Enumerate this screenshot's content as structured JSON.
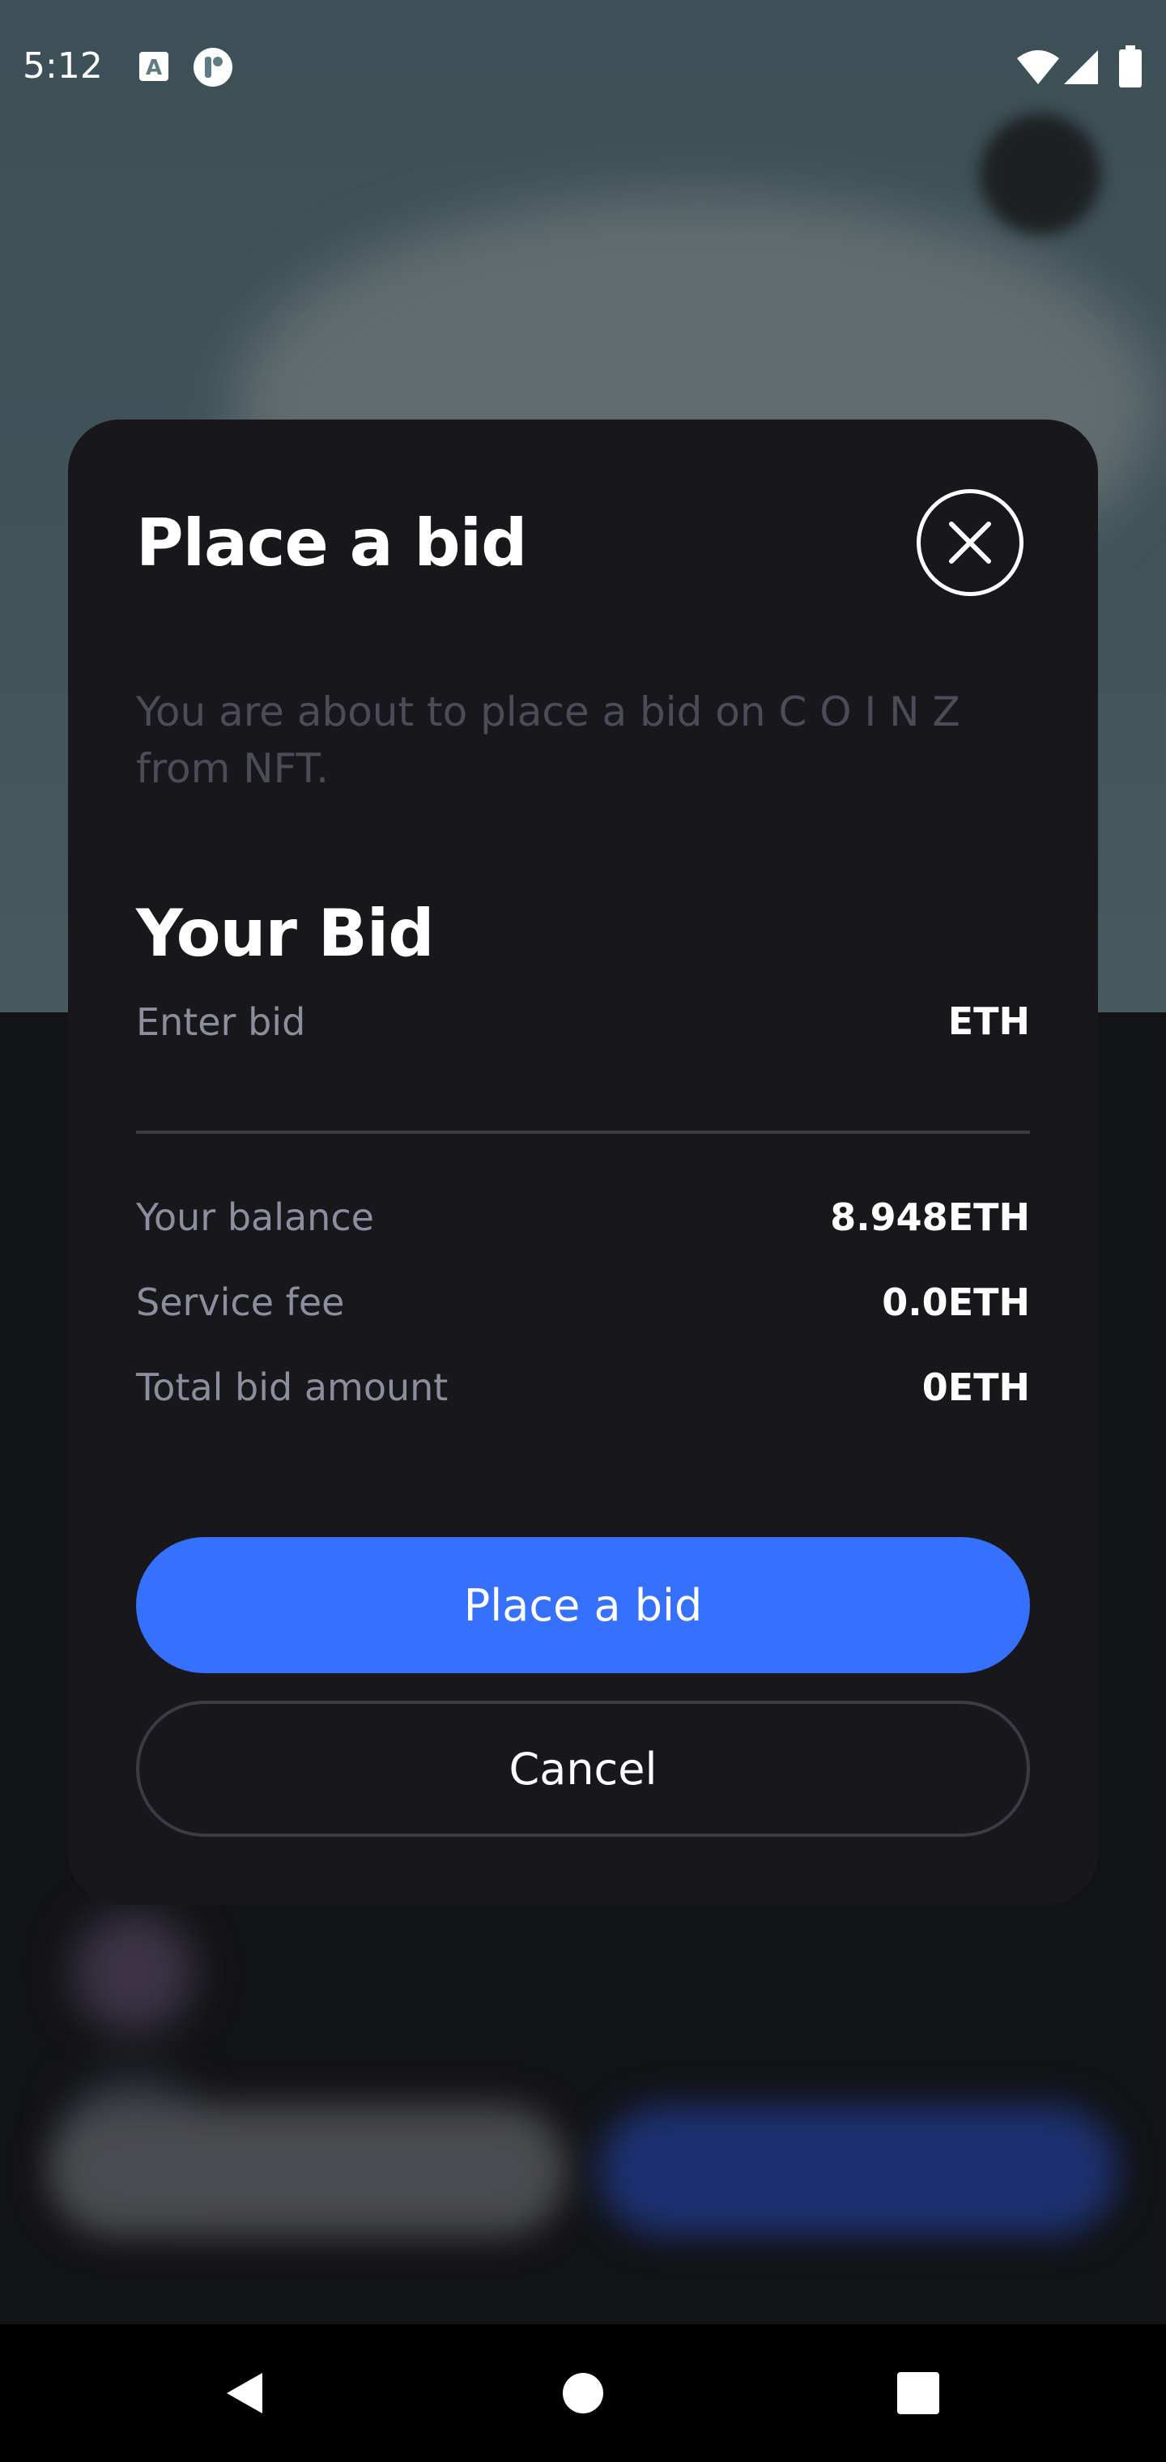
{
  "status_bar": {
    "time": "5:12",
    "icons": [
      "a-notification-icon",
      "app-notification-icon",
      "wifi-icon",
      "signal-icon",
      "battery-icon"
    ]
  },
  "modal": {
    "title": "Place a bid",
    "close_icon": "close-icon",
    "description": "You are about to place a bid on C O I N Z from NFT.",
    "section_title": "Your Bid",
    "bid_input": {
      "placeholder": "Enter bid",
      "value": "",
      "currency": "ETH"
    },
    "summary": [
      {
        "label": "Your balance",
        "value": "8.948ETH"
      },
      {
        "label": "Service fee",
        "value": "0.0ETH"
      },
      {
        "label": "Total bid amount",
        "value": "0ETH"
      }
    ],
    "primary_button": "Place a bid",
    "secondary_button": "Cancel"
  },
  "nav_bar": {
    "back_icon": "back-icon",
    "home_icon": "home-icon",
    "recents_icon": "recents-icon"
  },
  "colors": {
    "modal_bg": "#18181c",
    "accent": "#3571fc",
    "muted_text": "#8b8e9e",
    "description_text": "#4a4c58"
  }
}
